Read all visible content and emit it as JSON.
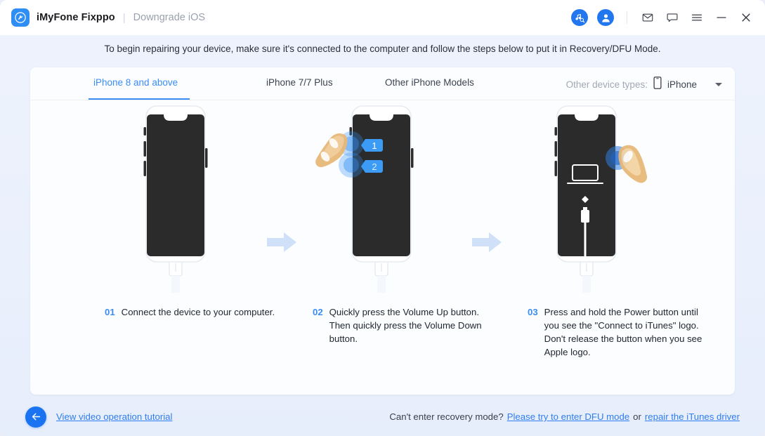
{
  "window": {
    "app_name": "iMyFone Fixppo",
    "mode_label": "Downgrade iOS",
    "separator": "|",
    "logo_icon": "wrench-in-circle-icon",
    "icons": {
      "itunes_detect": "itunes-search-icon",
      "account": "user-account-icon",
      "mail": "mail-icon",
      "feedback": "chat-bubble-icon",
      "menu": "hamburger-menu-icon",
      "minimize": "minimize-icon",
      "close": "close-icon"
    }
  },
  "banner": {
    "text": "To begin repairing your device, make sure it's connected to the computer and follow the steps below to put it in Recovery/DFU Mode."
  },
  "tabs": [
    {
      "label": "iPhone 8 and above",
      "active": true
    },
    {
      "label": "iPhone 7/7 Plus",
      "active": false
    },
    {
      "label": "Other iPhone Models",
      "active": false
    }
  ],
  "device_type": {
    "label": "Other device types:",
    "value": "iPhone",
    "icon": "phone-icon",
    "caret": "chevron-down-icon"
  },
  "steps": [
    {
      "number": "01",
      "text": "Connect the device to your computer.",
      "art": "iphone-connected"
    },
    {
      "number": "02",
      "text": "Quickly press the Volume Up button. Then quickly press the Volume Down button.",
      "art": "iphone-volume-press",
      "badges": [
        "1",
        "2"
      ]
    },
    {
      "number": "03",
      "text": "Press and hold the Power button until you see the \"Connect to iTunes\" logo. Don't release the button when you see Apple logo.",
      "art": "iphone-connect-to-itunes"
    }
  ],
  "footer": {
    "back_icon": "back-arrow-icon",
    "tutorial_link": "View video operation tutorial",
    "question": "Can't enter recovery mode?",
    "dfu_link": "Please try to enter DFU mode",
    "or_text": "or",
    "itunes_link": "repair the iTunes driver"
  },
  "colors": {
    "accent": "#3b8cf5",
    "link": "#2f7df0",
    "brand_blue": "#2f8ef4",
    "page_bg": "#eef3fd",
    "card_bg": "#fbfdff",
    "arrow_blue": "#cfe0f8",
    "screen_dark": "#2b2b2b",
    "hand": "#e8b878"
  }
}
